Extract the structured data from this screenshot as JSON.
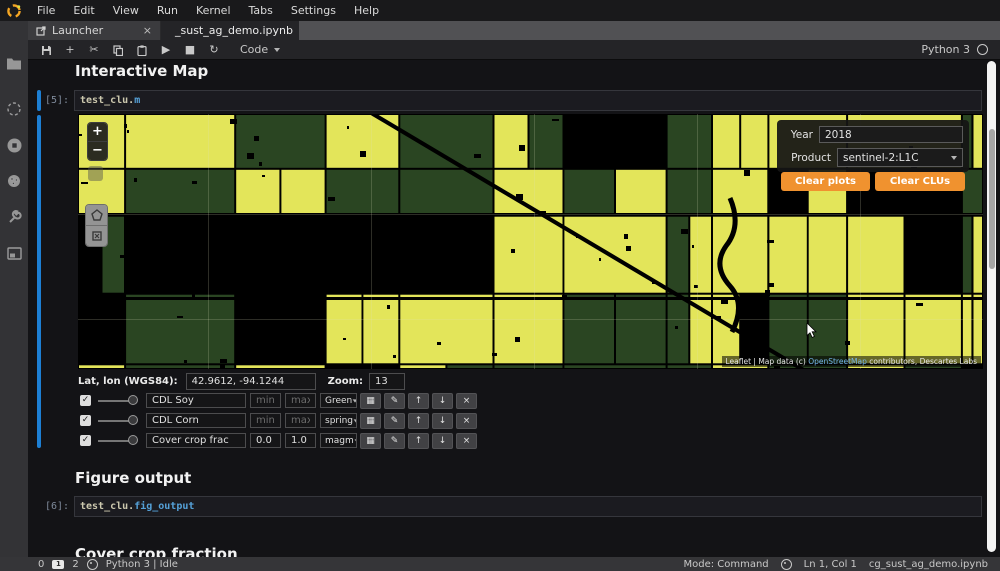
{
  "menu": {
    "items": [
      "File",
      "Edit",
      "View",
      "Run",
      "Kernel",
      "Tabs",
      "Settings",
      "Help"
    ]
  },
  "tab_bar": {
    "launcher": {
      "label": "Launcher",
      "close": "×"
    },
    "notebook": {
      "label": "_sust_ag_demo.ipynb"
    }
  },
  "toolbar": {
    "cell_type": "Code",
    "kernel_name": "Python 3",
    "icons": {
      "add": "+",
      "cut": "✂",
      "run": "▶",
      "stop": "■",
      "restart": "↻"
    }
  },
  "notebook": {
    "section1_title": "Interactive Map",
    "cell5": {
      "prompt": "[5]:",
      "code_obj": "test_clu.",
      "code_attr": "m"
    },
    "map": {
      "zoom_in": "+",
      "zoom_out": "−",
      "year_label": "Year",
      "year_value": "2018",
      "product_label": "Product",
      "product_value": "sentinel-2:L1C",
      "clear_plots_label": "Clear plots",
      "clear_clus_label": "Clear CLUs",
      "attribution": {
        "prefix": "Leaflet | Map data (c) ",
        "link": "OpenStreetMap",
        "suffix": " contributors, Descartes Labs"
      },
      "colors": {
        "yellow": "#e3e55a",
        "green": "#2a4522",
        "road": "#000000",
        "grid": "rgba(225,225,190,0.20)"
      }
    },
    "coords_bar": {
      "latlon_label": "Lat, lon (WGS84):",
      "latlon_value": "42.9612, -94.1244",
      "zoom_label": "Zoom:",
      "zoom_value": "13"
    },
    "layers": [
      {
        "check": "✓",
        "name": "CDL Soy",
        "min_value": "",
        "max_value": "",
        "min_placeholder": "min",
        "max_placeholder": "max",
        "cmap": "Green"
      },
      {
        "check": "✓",
        "name": "CDL Corn",
        "min_value": "",
        "max_value": "",
        "min_placeholder": "min",
        "max_placeholder": "max",
        "cmap": "spring"
      },
      {
        "check": "✓",
        "name": "Cover crop frac",
        "min_value": "0.0",
        "max_value": "1.0",
        "min_placeholder": "",
        "max_placeholder": "",
        "cmap": "magm"
      }
    ],
    "layer_buttons": {
      "grid": "▦",
      "edit": "✎",
      "up": "↑",
      "down": "↓",
      "remove": "×"
    },
    "section2_title": "Figure output",
    "cell6": {
      "prompt": "[6]:",
      "code_obj": "test_clu.",
      "code_attr": "fig_output"
    },
    "section3_title": "Cover crop fraction"
  },
  "status_bar": {
    "terminals_count": "0",
    "kernels_count": "2",
    "kernel_status": "Python 3 | Idle",
    "mode": "Mode: Command",
    "cursor_position": "Ln 1, Col 1",
    "filename": "cg_sust_ag_demo.ipynb"
  }
}
